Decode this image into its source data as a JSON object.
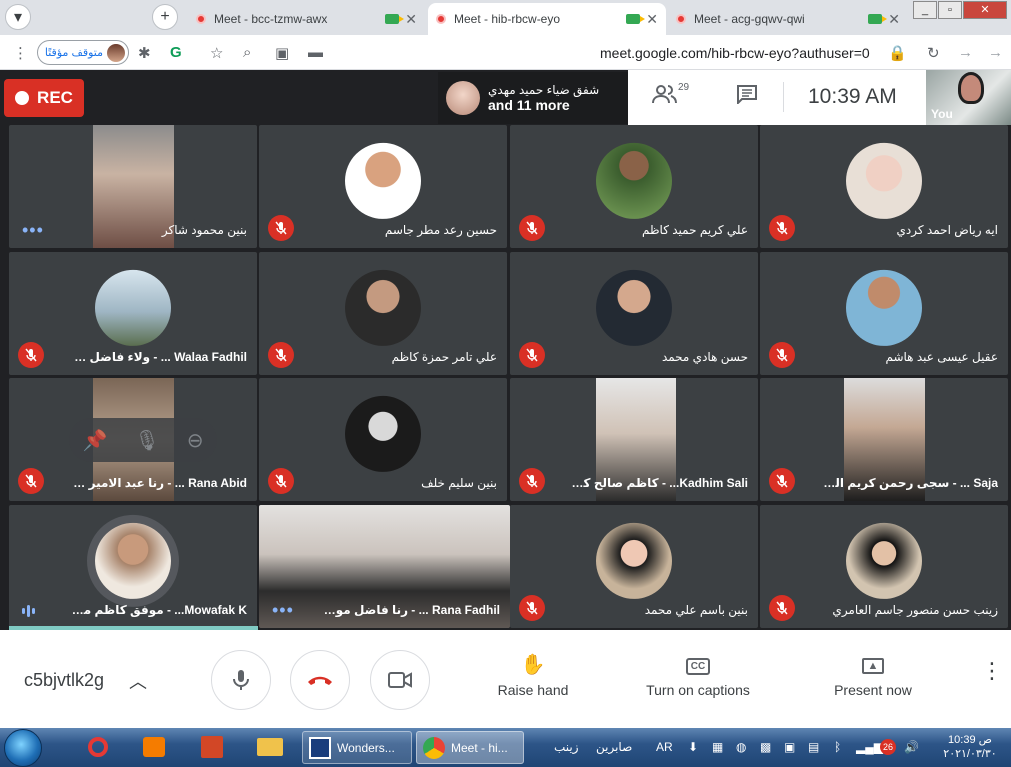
{
  "browser": {
    "tabs": [
      {
        "title": "Meet - bcc-tzmw-awx",
        "active": false
      },
      {
        "title": "Meet - hib-rbcw-eyo",
        "active": true
      },
      {
        "title": "Meet - acg-gqwv-qwi",
        "active": false
      }
    ],
    "new_tab_glyph": "+",
    "profile_label": "متوقف مؤقتًا",
    "url": "meet.google.com/hib-rbcw-eyo?authuser=0"
  },
  "meet": {
    "rec_label": "REC",
    "presenter_name": "شفق ضياء حميد مهدي",
    "presenter_more": "and 11 more",
    "participant_count": "29",
    "time": "10:39  AM",
    "self_label": "You",
    "tiles": [
      {
        "name": "بنين محمود شاكر",
        "indicator": "dots"
      },
      {
        "name": "حسين رعد مطر جاسم",
        "indicator": "muted"
      },
      {
        "name": "علي كريم حميد كاظم",
        "indicator": "muted"
      },
      {
        "name": "ايه رياض احمد كردي",
        "indicator": "muted"
      },
      {
        "name": "Walaa Fadhil ... - ولاء فاضل عبيد",
        "indicator": "muted"
      },
      {
        "name": "علي تامر حمزة كاظم",
        "indicator": "muted"
      },
      {
        "name": "حسن هادي محمد",
        "indicator": "muted"
      },
      {
        "name": "عقيل عيسى عبد هاشم",
        "indicator": "muted"
      },
      {
        "name": "Rana Abid ... - رنا عبد الامير جواد",
        "indicator": "muted"
      },
      {
        "name": "بنين سليم خلف",
        "indicator": "muted"
      },
      {
        "name": "Kadhim Sali... - كاظم صالح كاظم",
        "indicator": "muted"
      },
      {
        "name": "Saja ... - سجى رحمن كريم الساعدي",
        "indicator": "muted"
      },
      {
        "name": "Mowafak K... - موفق كاظم محسن",
        "indicator": "speaking"
      },
      {
        "name": "Rana Fadhil ... - رنا فاضل موسى",
        "indicator": "dots"
      },
      {
        "name": "بنين باسم علي محمد",
        "indicator": "muted"
      },
      {
        "name": "زينب حسن منصور جاسم العامري",
        "indicator": "muted"
      }
    ],
    "meeting_code": "c5bjvtlk2g",
    "actions": {
      "raise_hand": "Raise hand",
      "captions": "Turn on captions",
      "present": "Present now"
    }
  },
  "taskbar": {
    "apps": [
      {
        "label": "Wonders..."
      },
      {
        "label": "Meet - hi..."
      }
    ],
    "toolbar_items": [
      "زينب",
      "صابرين"
    ],
    "lang": "AR",
    "notif_count": "26",
    "time": "10:39 ص",
    "date": "٢٠٢١/٠٣/٣٠"
  }
}
